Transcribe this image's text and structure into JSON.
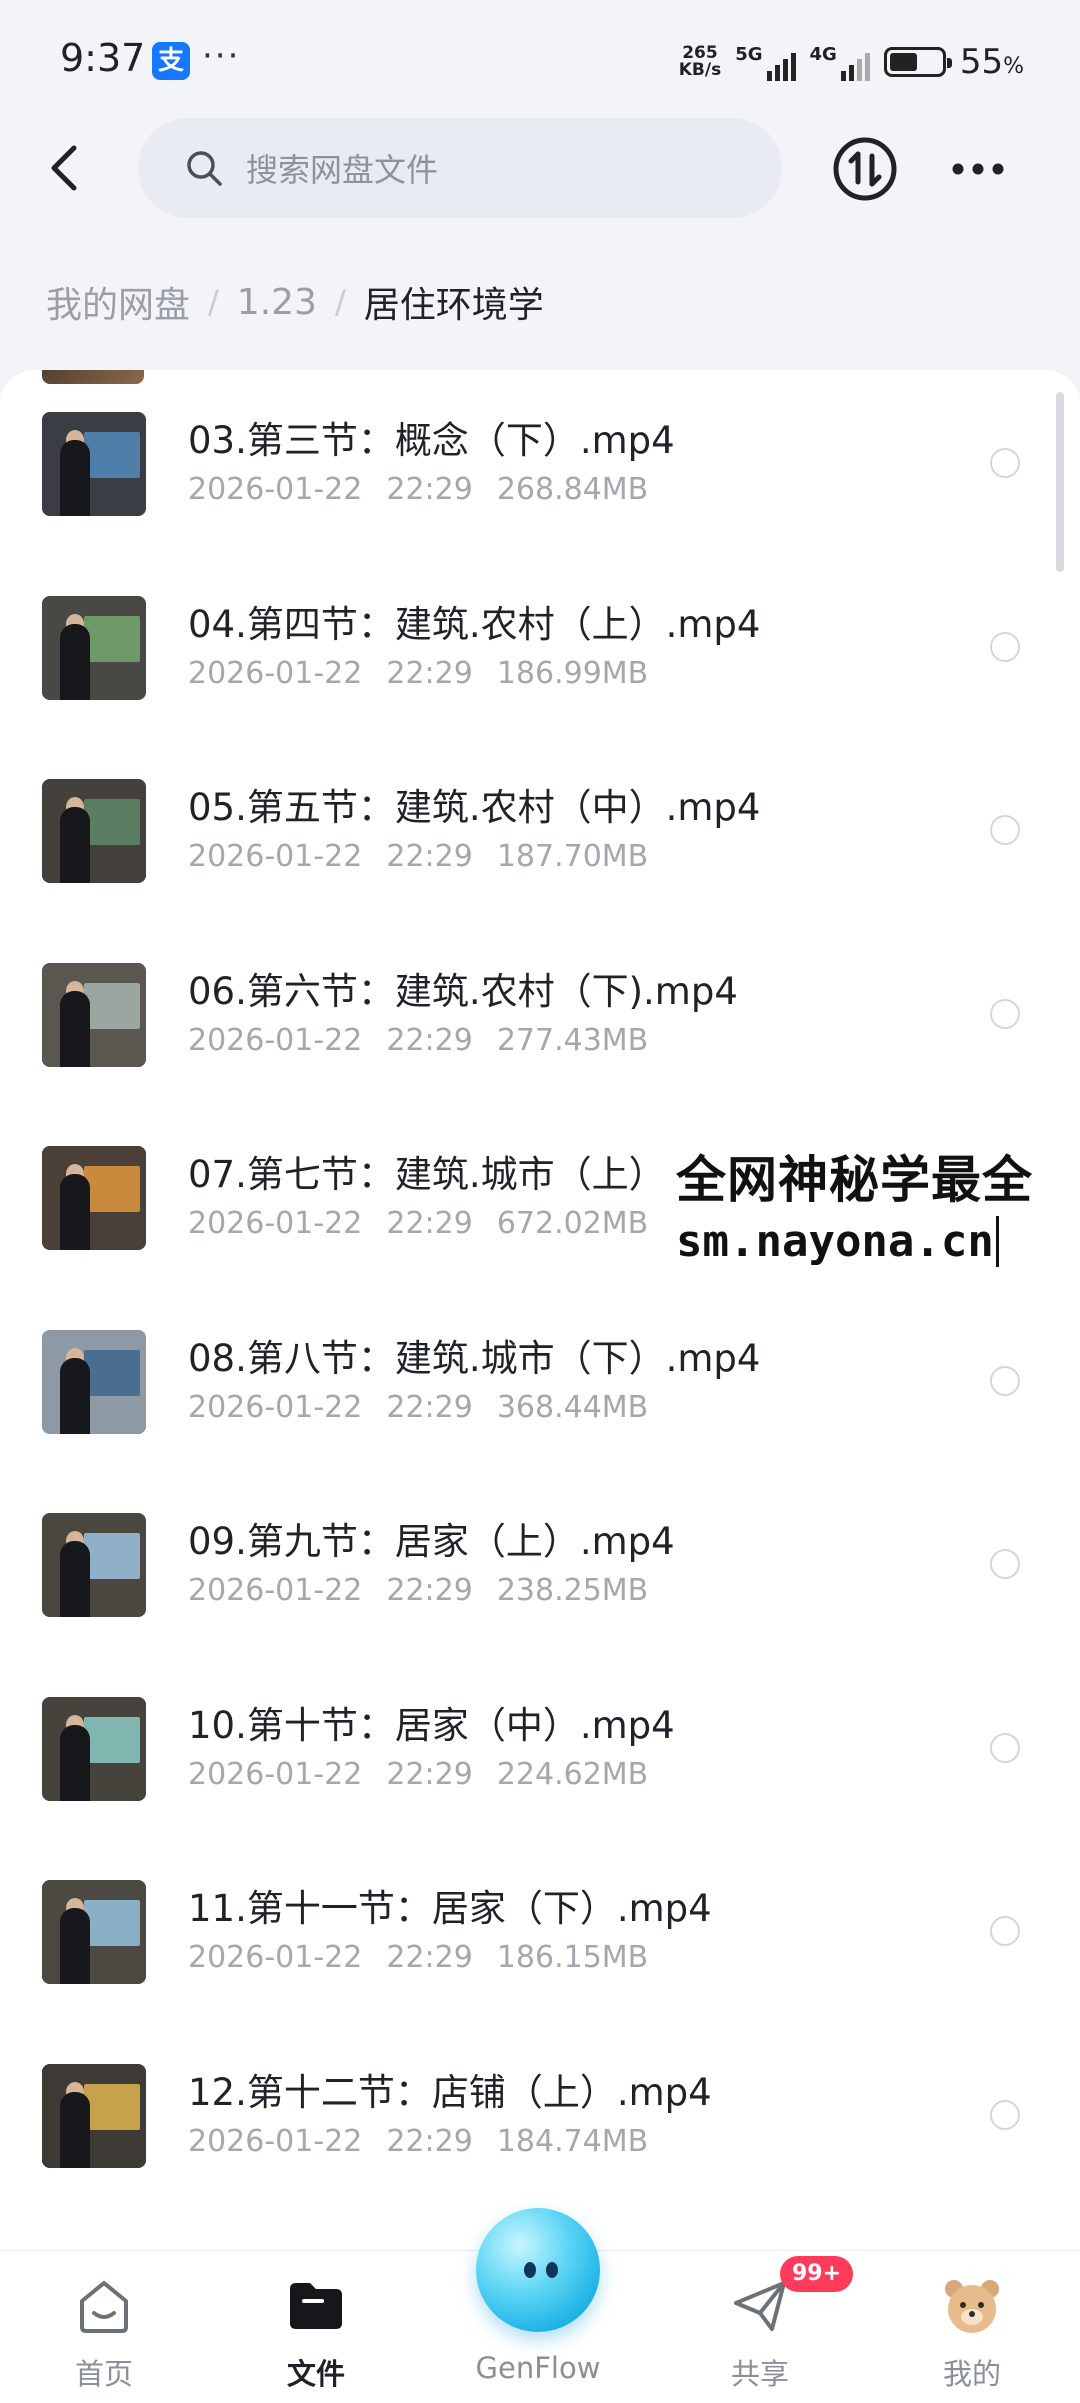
{
  "status_bar": {
    "time": "9:37",
    "alipay_label": "支",
    "more_dots": "···",
    "speed_value": "265",
    "speed_unit": "KB/s",
    "net1": "5G",
    "net2": "4G",
    "battery_percent": "55",
    "battery_symbol": "%",
    "battery_level": 0.55
  },
  "header": {
    "search_placeholder": "搜索网盘文件"
  },
  "breadcrumb": {
    "items": [
      "我的网盘",
      "1.23"
    ],
    "separator": "/",
    "current": "居住环境学"
  },
  "files": [
    {
      "name": "03.第三节：概念（下）.mp4",
      "date": "2026-01-22",
      "time": "22:29",
      "size": "268.84MB",
      "thumb": {
        "wall": "#3a3d44",
        "screen": "#4f7fa8"
      }
    },
    {
      "name": "04.第四节：建筑.农村（上）.mp4",
      "date": "2026-01-22",
      "time": "22:29",
      "size": "186.99MB",
      "thumb": {
        "wall": "#4a4844",
        "screen": "#6e9a6a"
      }
    },
    {
      "name": "05.第五节：建筑.农村（中）.mp4",
      "date": "2026-01-22",
      "time": "22:29",
      "size": "187.70MB",
      "thumb": {
        "wall": "#44403c",
        "screen": "#5a7e62"
      }
    },
    {
      "name": "06.第六节：建筑.农村（下).mp4",
      "date": "2026-01-22",
      "time": "22:29",
      "size": "277.43MB",
      "thumb": {
        "wall": "#5a5650",
        "screen": "#9aa7a0"
      }
    },
    {
      "name": "07.第七节：建筑.城市（上）",
      "date": "2026-01-22",
      "time": "22:29",
      "size": "672.02MB",
      "thumb": {
        "wall": "#4b4038",
        "screen": "#c88a3c"
      }
    },
    {
      "name": "08.第八节：建筑.城市（下）.mp4",
      "date": "2026-01-22",
      "time": "22:29",
      "size": "368.44MB",
      "thumb": {
        "wall": "#8d9aa6",
        "screen": "#4a6e8e"
      }
    },
    {
      "name": "09.第九节：居家（上）.mp4",
      "date": "2026-01-22",
      "time": "22:29",
      "size": "238.25MB",
      "thumb": {
        "wall": "#4a4640",
        "screen": "#8fb0c8"
      }
    },
    {
      "name": "10.第十节：居家（中）.mp4",
      "date": "2026-01-22",
      "time": "22:29",
      "size": "224.62MB",
      "thumb": {
        "wall": "#46423c",
        "screen": "#7fb6b0"
      }
    },
    {
      "name": "11.第十一节：居家（下）.mp4",
      "date": "2026-01-22",
      "time": "22:29",
      "size": "186.15MB",
      "thumb": {
        "wall": "#4c4842",
        "screen": "#8ab0c6"
      }
    },
    {
      "name": "12.第十二节：店铺（上）.mp4",
      "date": "2026-01-22",
      "time": "22:29",
      "size": "184.74MB",
      "thumb": {
        "wall": "#3e3a36",
        "screen": "#c7a24a"
      }
    }
  ],
  "watermark": {
    "line1": "全网神秘学最全",
    "line2": "sm.nayona.cn"
  },
  "bottom_nav": {
    "home": "首页",
    "files": "文件",
    "genflow": "GenFlow",
    "share": "共享",
    "mine": "我的",
    "share_badge": "99+"
  },
  "colors": {
    "accent_badge": "#ff3b5c",
    "genflow_orb": "#3cc6ee"
  }
}
